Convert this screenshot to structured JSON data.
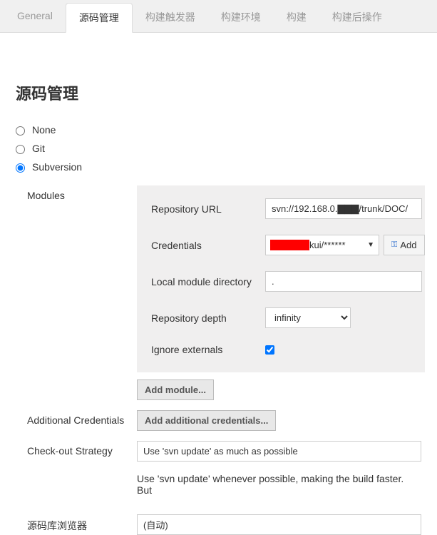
{
  "tabs": {
    "general": "General",
    "scm": "源码管理",
    "triggers": "构建触发器",
    "env": "构建环境",
    "build": "构建",
    "post": "构建后操作"
  },
  "section_title": "源码管理",
  "scm_options": {
    "none": "None",
    "git": "Git",
    "svn": "Subversion"
  },
  "svn": {
    "modules_label": "Modules",
    "repo_url_label": "Repository URL",
    "repo_url_value": "svn://192.168.0.▇▇▇/trunk/DOC/",
    "credentials_label": "Credentials",
    "credentials_value_suffix": "kui/******",
    "add_button": "Add",
    "local_dir_label": "Local module directory",
    "local_dir_value": ".",
    "depth_label": "Repository depth",
    "depth_value": "infinity",
    "ignore_ext_label": "Ignore externals",
    "add_module_button": "Add module...",
    "additional_creds_label": "Additional Credentials",
    "add_additional_button": "Add additional credentials...",
    "checkout_label": "Check-out Strategy",
    "checkout_value": "Use 'svn update' as much as possible",
    "checkout_help": "Use 'svn update' whenever possible, making the build faster. But",
    "browser_label": "源码库浏览器",
    "browser_value": "(自动)"
  }
}
